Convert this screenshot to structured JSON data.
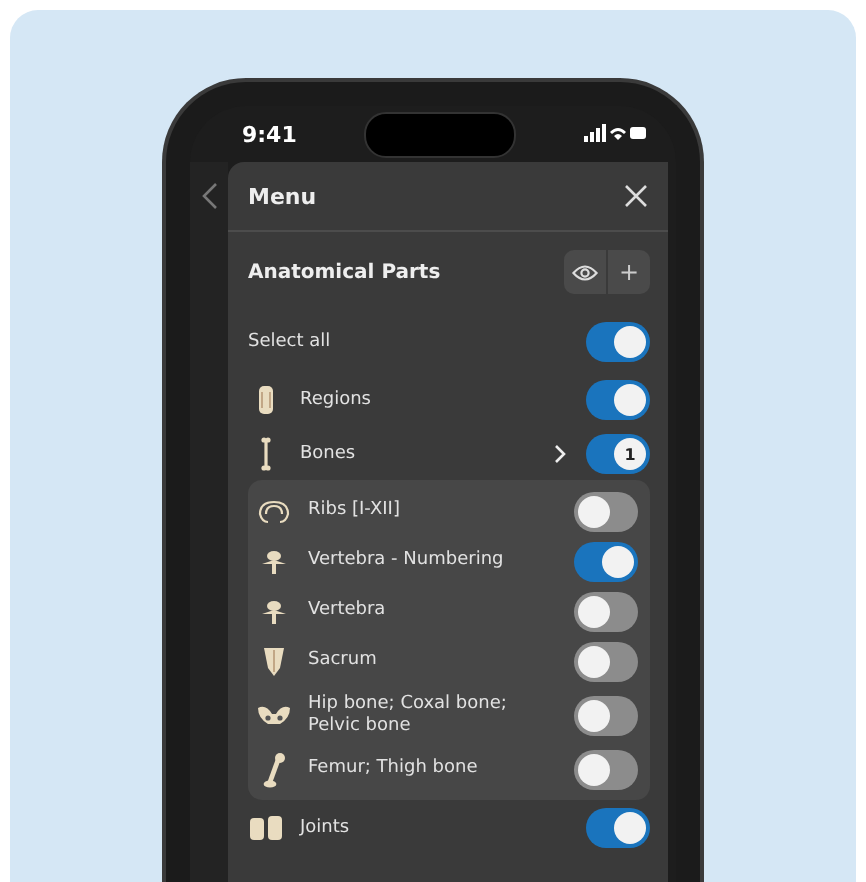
{
  "status_bar": {
    "time": "9:41"
  },
  "menu": {
    "title": "Menu",
    "section_title": "Anatomical Parts",
    "add_label": "+"
  },
  "rows": [
    {
      "kind": "plain",
      "label": "Select all",
      "on": true
    },
    {
      "kind": "regions",
      "label": "Regions",
      "on": true
    },
    {
      "kind": "bones",
      "label": "Bones",
      "on": true,
      "badge": "1",
      "children": [
        {
          "kind": "ribs",
          "label": "Ribs [I-XII]",
          "on": false
        },
        {
          "kind": "vertebra",
          "label": "Vertebra - Numbering",
          "on": true
        },
        {
          "kind": "vertebra",
          "label": "Vertebra",
          "on": false
        },
        {
          "kind": "sacrum",
          "label": "Sacrum",
          "on": false
        },
        {
          "kind": "hip",
          "label": "Hip bone; Coxal bone; Pelvic bone",
          "on": false
        },
        {
          "kind": "femur",
          "label": "Femur; Thigh bone",
          "on": false
        }
      ]
    },
    {
      "kind": "joints",
      "label": "Joints",
      "on": true
    }
  ]
}
